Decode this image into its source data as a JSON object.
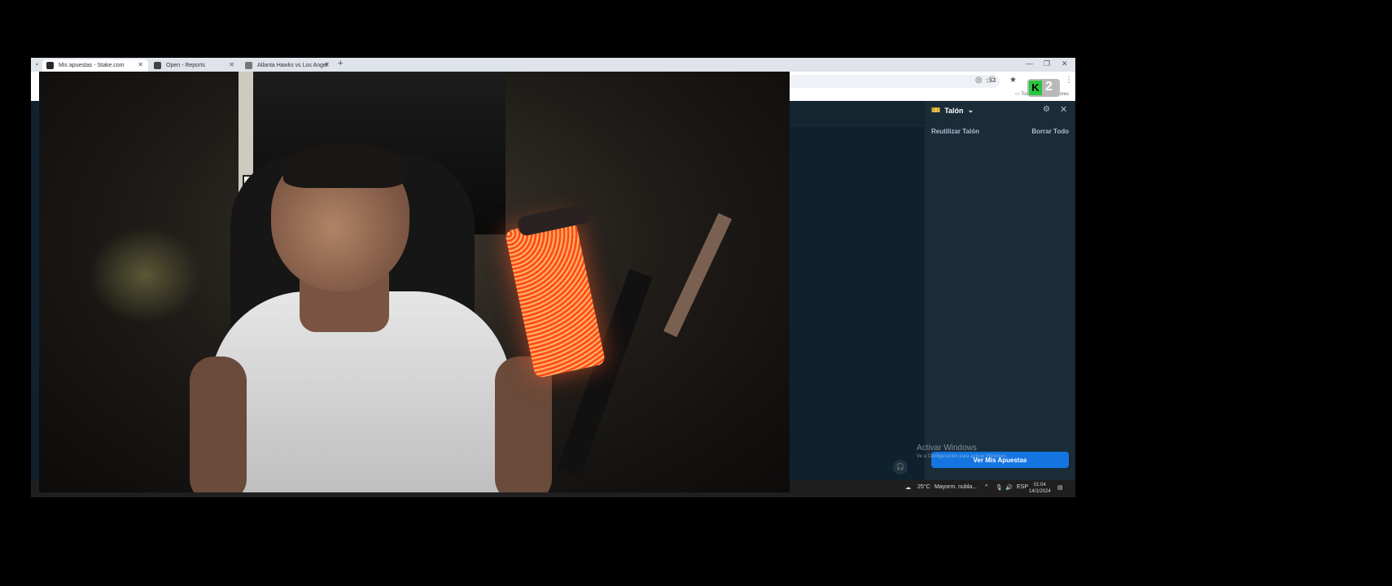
{
  "browser": {
    "tabs": [
      {
        "title": "Mis apuestas - Stake.com",
        "active": true
      },
      {
        "title": "Open - Reports",
        "active": false
      },
      {
        "title": "Atlanta Hawks vs Los Angel",
        "active": false
      }
    ],
    "new_tab_label": "+",
    "bookmarks_label": "Todos los marcadores"
  },
  "betslip": {
    "title": "Talón",
    "reuse_label": "Reutilizar Talón",
    "clear_label": "Borrar Todo",
    "view_bets_label": "Ver Mis Apuestas"
  },
  "watermark": {
    "line1": "Activar Windows",
    "line2": "Ve a Configuración para activar Windows."
  },
  "taskbar": {
    "weather": "25°C",
    "weather_desc": "Mayorm. nubla...",
    "lang": "ESP",
    "time": "01:04",
    "date": "14/1/2024"
  },
  "overlay": {
    "k_letter": "K",
    "number": "2"
  }
}
